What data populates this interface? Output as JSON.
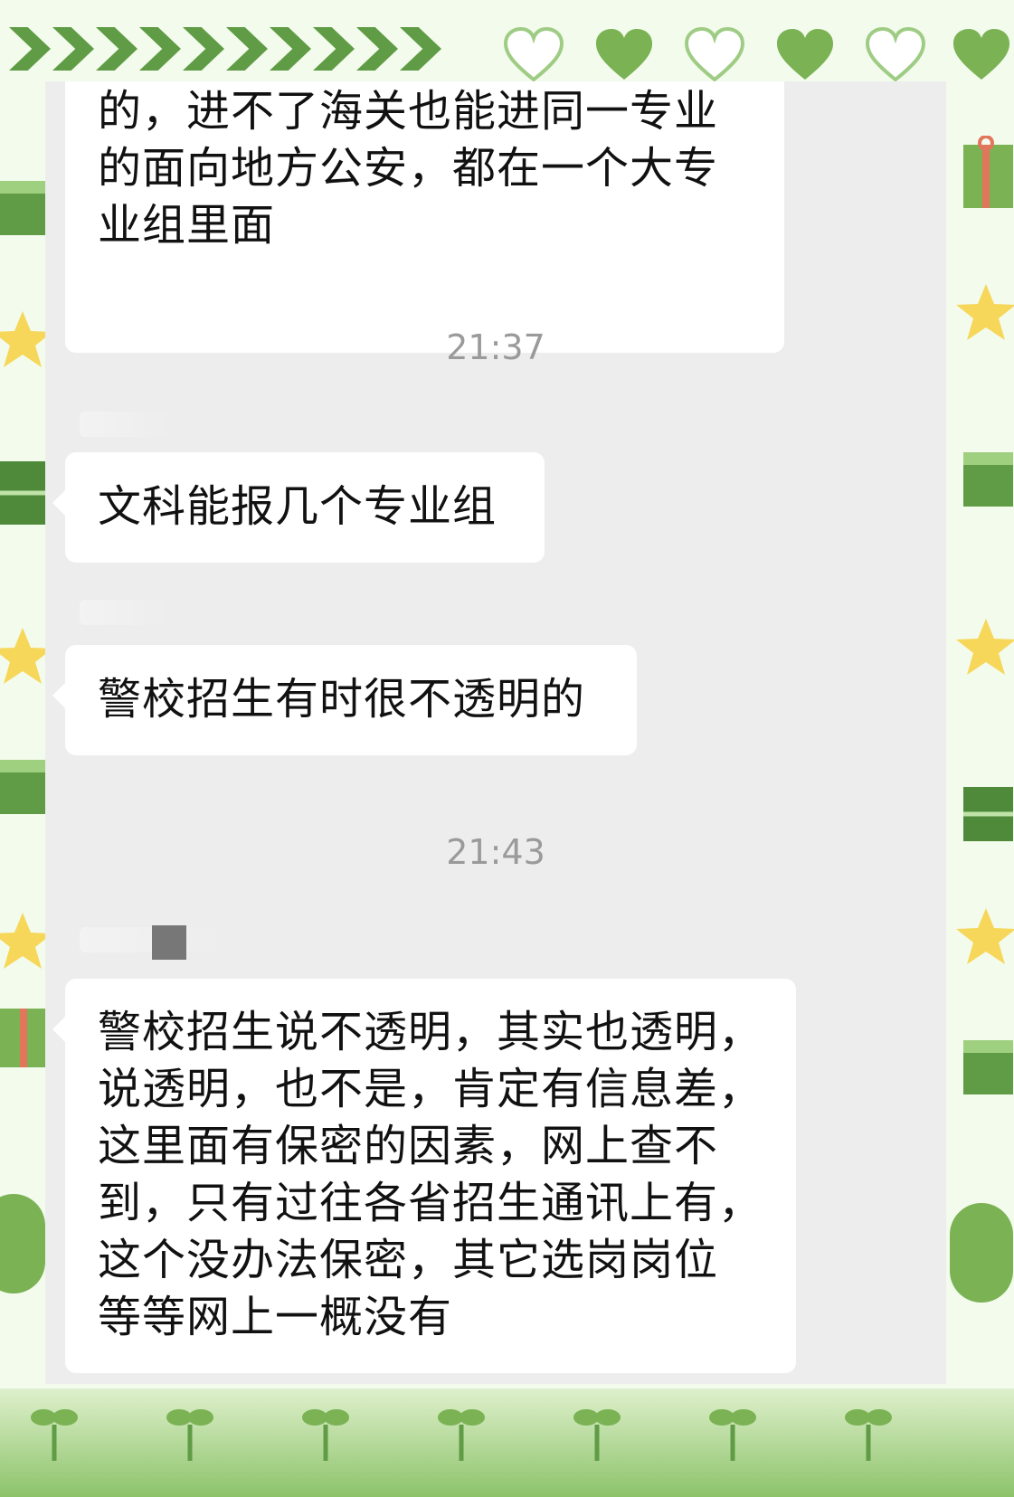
{
  "theme": {
    "accent": "#5f9c45",
    "panel_bg": "#ededed",
    "bubble_bg": "#ffffff",
    "timestamp_color": "#9a9a9a"
  },
  "chat": {
    "messages": [
      {
        "lines": [
          "的，进不了海关也能进同一专业",
          "的面向地方公安，都在一个大专",
          "业组里面"
        ]
      },
      {
        "timestamp": "21:37"
      },
      {
        "lines": [
          "文科能报几个专业组"
        ]
      },
      {
        "lines": [
          "警校招生有时很不透明的"
        ]
      },
      {
        "timestamp": "21:43"
      },
      {
        "lines": [
          "警校招生说不透明，其实也透明，",
          "说透明，也不是，肯定有信息差，",
          "这里面有保密的因素，网上查不",
          "到，只有过往各省招生通讯上有，",
          "这个没办法保密，其它选岗岗位",
          "等等网上一概没有"
        ]
      }
    ]
  },
  "decorations": {
    "icons": [
      "chevron-icon",
      "heart-icon",
      "gift-icon",
      "star-icon",
      "sprout-icon",
      "bean-character-icon"
    ]
  }
}
